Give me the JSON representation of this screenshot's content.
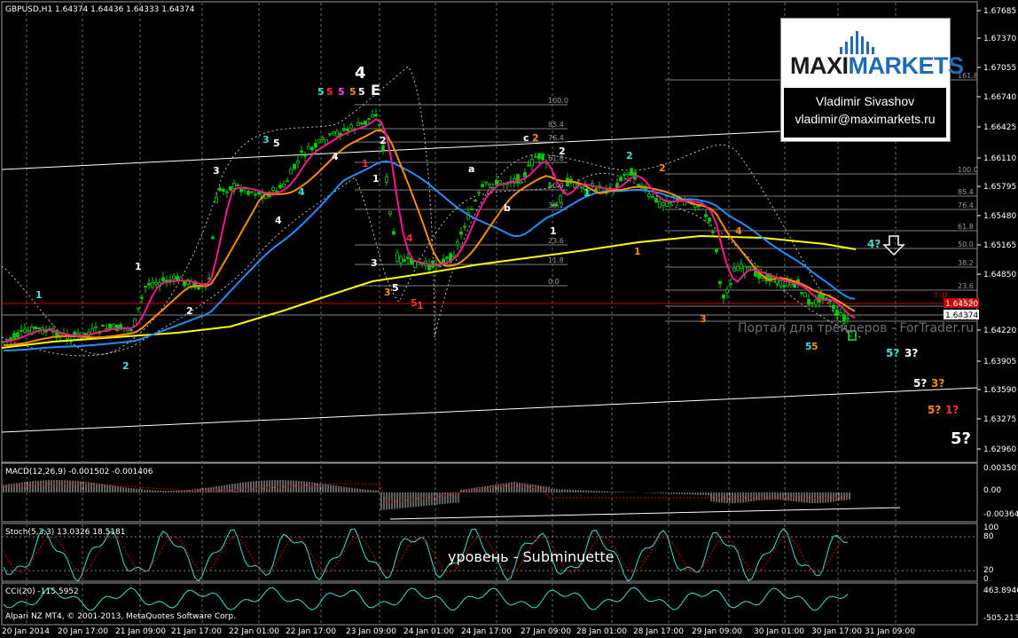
{
  "header": {
    "symbol_info": "GBPUSD,H1  1.64374  1.64436  1.64333  1.64374"
  },
  "indicators": {
    "macd": "MACD(12,26,9) -0.001502 -0.001406",
    "stoch": "Stoch(5,3,3) 13.0326 18.5181",
    "cci": "CCI(20) -115.5952"
  },
  "footer": {
    "copyright": "Alpari NZ MT4, © 2001-2013, MetaQuotes Software Corp."
  },
  "logo": {
    "brand_part1": "MAXI",
    "brand_part2": "MARKETS",
    "name": "Vladimir Sivashov",
    "email": "vladimir@maximarkets.ru"
  },
  "overlay_texts": {
    "watermark": "Портал для трейдеров - ForTrader.ru",
    "sublabel": "уровень - Subminuette",
    "tp": "т.р."
  },
  "colors": {
    "background": "#000000",
    "candle": "#00cc00",
    "ema_fast": "#ff1493",
    "ema_mid": "#ff8c00",
    "ema_slow": "#1e90ff",
    "ema_long": "#ffff00",
    "price_box": "#cc0000",
    "cyan": "#40e0d0",
    "grid": "#ffffff"
  },
  "chart_data": {
    "type": "candlestick",
    "ylim": [
      1.6255,
      1.678
    ],
    "price_ticks": [
      "1.67685",
      "1.67370",
      "1.67055",
      "1.66740",
      "1.66425",
      "1.66110",
      "1.65795",
      "1.65480",
      "1.65165",
      "1.64850",
      "1.64520",
      "1.64374",
      "1.64220",
      "1.63905",
      "1.63590",
      "1.63275",
      "1.62960"
    ],
    "time_ticks": [
      "20 Jan 2014",
      "20 Jan 17:00",
      "21 Jan 09:00",
      "21 Jan 17:00",
      "22 Jan 01:00",
      "22 Jan 17:00",
      "23 Jan 09:00",
      "24 Jan 01:00",
      "24 Jan 17:00",
      "27 Jan 09:00",
      "28 Jan 01:00",
      "28 Jan 17:00",
      "29 Jan 09:00",
      "30 Jan 01:00",
      "30 Jan 17:00",
      "31 Jan 09:00"
    ],
    "current_price": "1.64374",
    "tp_price": "1.64520",
    "fib_levels": [
      "100.0",
      "85.4",
      "76.4",
      "61.8",
      "50.0",
      "38.2",
      "23.6",
      "11.8",
      "0.0"
    ],
    "fib_right_levels": [
      "161.8",
      "100.0",
      "85.4",
      "76.4",
      "61.8",
      "50.0",
      "38.2",
      "23.6",
      "11.8",
      "0.0"
    ],
    "macd_ticks": [
      "0.003501",
      "0.00",
      "-0.00364"
    ],
    "stoch_ticks": [
      "100",
      "80",
      "20",
      "0"
    ],
    "cci_ticks": [
      "463.8946",
      "-505.2135"
    ],
    "wave_labels": [
      {
        "t": "1",
        "c": "#40e0d0"
      },
      {
        "t": "2",
        "c": "#40e0d0"
      },
      {
        "t": "1",
        "c": "#ffffff"
      },
      {
        "t": "2",
        "c": "#ffffff"
      },
      {
        "t": "3",
        "c": "#ffffff"
      },
      {
        "t": "4",
        "c": "#ffffff"
      },
      {
        "t": "3",
        "c": "#40e0d0"
      },
      {
        "t": "5",
        "c": "#ffffff"
      },
      {
        "t": "4",
        "c": "#40e0d0"
      },
      {
        "t": "4",
        "c": "#ffffff"
      },
      {
        "t": "5",
        "c": "#40e0d0"
      },
      {
        "t": "5",
        "c": "#ff3030"
      },
      {
        "t": "5",
        "c": "#ff40ff"
      },
      {
        "t": "5",
        "c": "#ff8c00"
      },
      {
        "t": "5",
        "c": "#ffffff"
      },
      {
        "t": "E",
        "c": "#ffffff"
      },
      {
        "t": "1",
        "c": "#ff3030"
      },
      {
        "t": "1",
        "c": "#ffffff"
      },
      {
        "t": "2",
        "c": "#ffffff"
      },
      {
        "t": "3",
        "c": "#ffffff"
      },
      {
        "t": "4",
        "c": "#ff3030"
      },
      {
        "t": "3",
        "c": "#ff8c00"
      },
      {
        "t": "5",
        "c": "#ffffff"
      },
      {
        "t": "5",
        "c": "#ff3030"
      },
      {
        "t": "1",
        "c": "#ff3030"
      },
      {
        "t": "a",
        "c": "#ffffff"
      },
      {
        "t": "b",
        "c": "#ffffff"
      },
      {
        "t": "c",
        "c": "#ffffff"
      },
      {
        "t": "2",
        "c": "#ff8c00"
      },
      {
        "t": "1",
        "c": "#ffffff"
      },
      {
        "t": "2",
        "c": "#ffffff"
      },
      {
        "t": "1",
        "c": "#40e0d0"
      },
      {
        "t": "2",
        "c": "#40e0d0"
      },
      {
        "t": "2",
        "c": "#ff8c00"
      },
      {
        "t": "1",
        "c": "#ff8c00"
      },
      {
        "t": "3",
        "c": "#ff8c00"
      },
      {
        "t": "4",
        "c": "#ff8c00"
      },
      {
        "t": "5",
        "c": "#40e0d0"
      },
      {
        "t": "5",
        "c": "#ff8c00"
      },
      {
        "t": "4?",
        "c": "#40e0d0"
      },
      {
        "t": "5?",
        "c": "#40e0d0"
      },
      {
        "t": "3?",
        "c": "#ffffff"
      },
      {
        "t": "5?",
        "c": "#ffffff"
      },
      {
        "t": "3?",
        "c": "#ff8c00"
      },
      {
        "t": "5?",
        "c": "#ff8c00"
      },
      {
        "t": "1?",
        "c": "#ff3030"
      },
      {
        "t": "5?",
        "c": "#ffffff"
      }
    ]
  }
}
